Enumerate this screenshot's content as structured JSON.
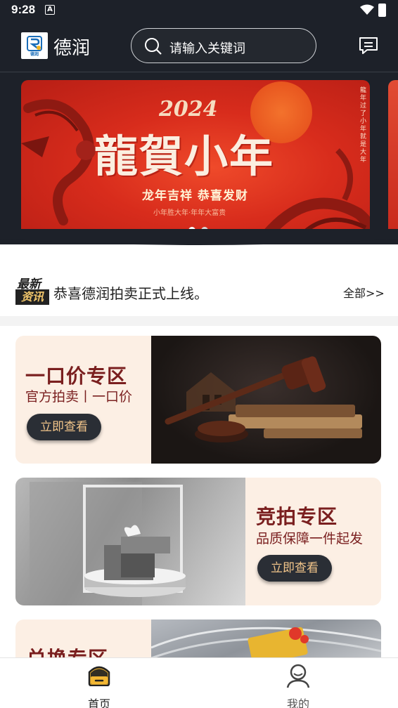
{
  "status_bar": {
    "time": "9:28",
    "notification_icon": "A"
  },
  "header": {
    "logo_text": "德润",
    "app_name": "德润",
    "search_placeholder": "请输入关键词",
    "message_icon": "message-icon"
  },
  "banner": {
    "year": "2024",
    "title": "龍賀小年",
    "subtitle": "龙年吉祥  恭喜发财",
    "tagline": "小年胜大年·年年大富贵",
    "side_text": "龍年 过了小年就是大年",
    "page_count": 2,
    "active_page": 1
  },
  "news": {
    "badge_top": "最新",
    "badge_bottom": "资讯",
    "headline": "恭喜德润拍卖正式上线。",
    "all_link": "全部>>"
  },
  "sections": [
    {
      "title": "一口价专区",
      "subtitle": "官方拍卖丨一口价",
      "button": "立即查看"
    },
    {
      "title": "竞拍专区",
      "subtitle": "品质保障一件起发",
      "button": "立即查看"
    },
    {
      "title": "兑换专区"
    }
  ],
  "bottom_nav": [
    {
      "label": "首页",
      "icon": "home-icon",
      "active": true
    },
    {
      "label": "我的",
      "icon": "user-icon",
      "active": false
    }
  ]
}
